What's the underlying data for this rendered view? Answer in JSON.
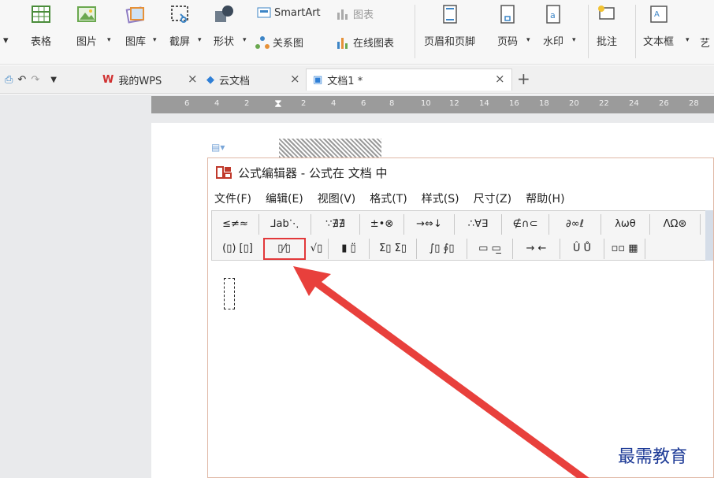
{
  "ribbon": {
    "buttons": [
      {
        "name": "table",
        "label": "表格",
        "icon": "table-icon"
      },
      {
        "name": "picture",
        "label": "图片",
        "icon": "picture-icon"
      },
      {
        "name": "gallery",
        "label": "图库",
        "icon": "gallery-icon"
      },
      {
        "name": "screenshot",
        "label": "截屏",
        "icon": "screenshot-icon"
      },
      {
        "name": "shape",
        "label": "形状",
        "icon": "shape-icon"
      },
      {
        "name": "relation",
        "label": "关系图",
        "icon": "relation-icon"
      },
      {
        "name": "header-footer",
        "label": "页眉和页脚",
        "icon": "header-footer-icon"
      },
      {
        "name": "page-number",
        "label": "页码",
        "icon": "page-number-icon"
      },
      {
        "name": "watermark",
        "label": "水印",
        "icon": "watermark-icon"
      },
      {
        "name": "comment",
        "label": "批注",
        "icon": "comment-icon"
      },
      {
        "name": "textbox",
        "label": "文本框",
        "icon": "textbox-icon"
      },
      {
        "name": "art",
        "label": "艺"
      }
    ],
    "smartart_label": "SmartArt",
    "chart_label": "图表",
    "online_chart_label": "在线图表"
  },
  "tabs": [
    {
      "label": "我的WPS",
      "icon": "wps-logo-icon"
    },
    {
      "label": "云文档",
      "icon": "cloud-doc-icon"
    },
    {
      "label": "文档1 *",
      "icon": "document-icon",
      "active": true
    }
  ],
  "ruler": {
    "ticks": [
      "6",
      "4",
      "2",
      "2",
      "4",
      "6",
      "8",
      "10",
      "12",
      "14",
      "16",
      "18",
      "20",
      "22",
      "24",
      "26",
      "28"
    ]
  },
  "equation_editor": {
    "title": "公式编辑器 - 公式在 文档 中",
    "menu": [
      "文件(F)",
      "编辑(E)",
      "视图(V)",
      "格式(T)",
      "样式(S)",
      "尺寸(Z)",
      "帮助(H)"
    ],
    "palette_row1": [
      "≤≠≈",
      "⅃ab⋱",
      "∵∄∄",
      "±•⊗",
      "→⇔↓",
      "∴∀∃",
      "∉∩⊂",
      "∂∞ℓ",
      "λωθ",
      "ΛΩ⊛"
    ],
    "palette_row2": [
      "(▯) [▯]",
      "▯⁄▯",
      "√▯",
      "▮ ▯̈",
      "Σ▯ Σ▯",
      "∫▯ ∮▯",
      "▭ ▭̲",
      "→ ←",
      "Û Ů",
      "▫▫ ▦"
    ],
    "highlighted_index": 1
  },
  "watermark_text": "最需教育",
  "colors": {
    "highlight": "#e2383a",
    "arrow": "#e8403c",
    "watermark": "#1d3a96"
  }
}
